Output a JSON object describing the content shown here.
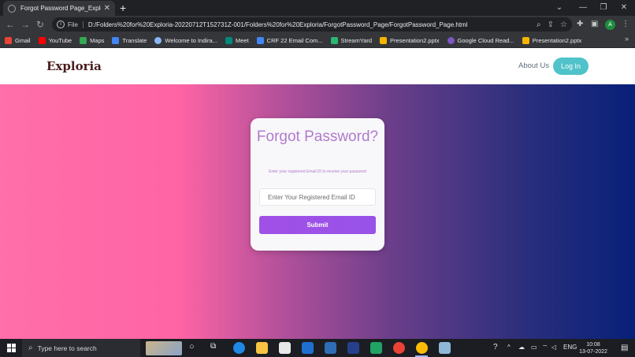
{
  "browser": {
    "tab_title": "Forgot Password Page_Exploria",
    "new_tab_label": "+",
    "scheme_label": "File",
    "url": "D:/Folders%20for%20Exploria-20220712T152731Z-001/Folders%20for%20Exploria/ForgotPassword_Page/ForgotPassword_Page.html",
    "profile_initial": "A",
    "bookmarks": [
      {
        "label": "Gmail",
        "color": "#ea4335"
      },
      {
        "label": "YouTube",
        "color": "#ff0000"
      },
      {
        "label": "Maps",
        "color": "#34a853"
      },
      {
        "label": "Translate",
        "color": "#4285f4"
      },
      {
        "label": "Welcome to Indira...",
        "color": "#8ab4f8"
      },
      {
        "label": "Meet",
        "color": "#00897b"
      },
      {
        "label": "CRF 22 Email Com...",
        "color": "#4285f4"
      },
      {
        "label": "StreamYard",
        "color": "#2bb673"
      },
      {
        "label": "Presentation2.pptx",
        "color": "#f4b400"
      },
      {
        "label": "Google Cloud Read...",
        "color": "#7e57c2"
      },
      {
        "label": "Presentation2.pptx",
        "color": "#f4b400"
      }
    ]
  },
  "site": {
    "brand": "Exploria",
    "nav": {
      "about": "About Us",
      "login": "Log In"
    },
    "form": {
      "title": "Forgot Password?",
      "subtitle": "Enter your registered Email ID to receive your password",
      "email_placeholder": "Enter Your Registered Email ID",
      "submit_label": "Submit"
    }
  },
  "taskbar": {
    "search_text": "Type here to search",
    "language": "ENG",
    "time": "10:08",
    "date": "13-07-2022"
  },
  "colors": {
    "accent": "#a150e6",
    "title": "#b17acc",
    "login_button": "#4fc3c9",
    "brand": "#4a1c1c"
  }
}
